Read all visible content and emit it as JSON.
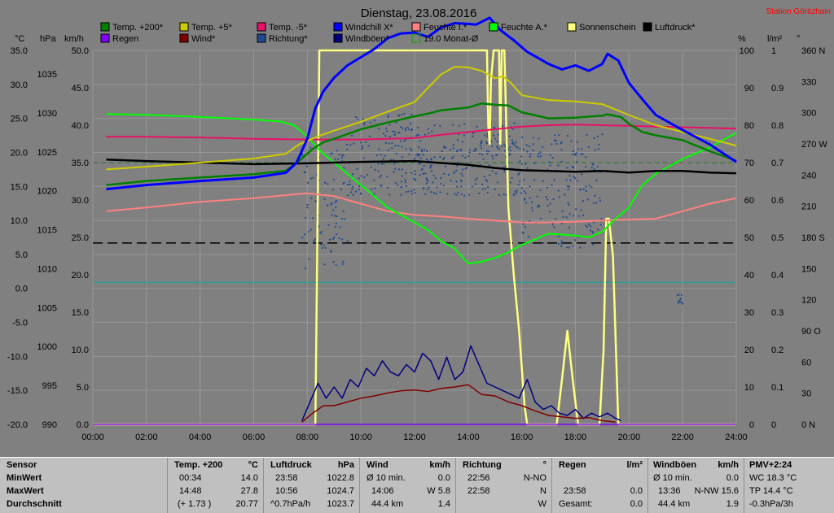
{
  "chart_data": {
    "type": "line",
    "title": "Dienstag, 23.08.2016",
    "station": "Station Göritzhain",
    "legend": [
      {
        "name": "Temp. +200*",
        "color": "#008000"
      },
      {
        "name": "Temp. +5*",
        "color": "#cccc00"
      },
      {
        "name": "Temp. -5*",
        "color": "#e8106a"
      },
      {
        "name": "Windchill X*",
        "color": "#0000ff"
      },
      {
        "name": "Feuchte I.*",
        "color": "#ff8080"
      },
      {
        "name": "Feuchte A.*",
        "color": "#00ff00"
      },
      {
        "name": "Sonnenschein",
        "color": "#ffff80"
      },
      {
        "name": "Luftdruck*",
        "color": "#000000"
      },
      {
        "name": "Regen",
        "color": "#8000ff"
      },
      {
        "name": "Wind*",
        "color": "#800000"
      },
      {
        "name": "Richtung*",
        "color": "#204a90"
      },
      {
        "name": "Windböen*",
        "color": "#000080"
      },
      {
        "name": "19.0 Monat-Ø",
        "color": "#00a000"
      }
    ],
    "axes": {
      "temp": {
        "unit": "°C",
        "ticks": [
          "35.0",
          "30.0",
          "25.0",
          "20.0",
          "15.0",
          "10.0",
          "5.0",
          "0.0",
          "-5.0",
          "-10.0",
          "-15.0",
          "-20.0"
        ],
        "range": [
          -20,
          35
        ]
      },
      "pressure": {
        "unit": "hPa",
        "ticks": [
          "1035",
          "1030",
          "1025",
          "1020",
          "1015",
          "1010",
          "1005",
          "1000",
          "995",
          "990"
        ],
        "range": [
          990,
          1039
        ]
      },
      "wind": {
        "unit": "km/h",
        "ticks": [
          "50.0",
          "45.0",
          "40.0",
          "35.0",
          "30.0",
          "25.0",
          "20.0",
          "15.0",
          "10.0",
          "5.0",
          "0.0"
        ],
        "range": [
          0,
          50
        ]
      },
      "humidity": {
        "unit": "%",
        "ticks": [
          "100",
          "90",
          "80",
          "70",
          "60",
          "50",
          "40",
          "30",
          "20",
          "10",
          "0"
        ],
        "range": [
          0,
          100
        ]
      },
      "rain": {
        "unit": "l/m²",
        "ticks": [
          "1",
          "0.9",
          "0.8",
          "0.7",
          "0.6",
          "0.5",
          "0.4",
          "0.3",
          "0.2",
          "0.1",
          "0"
        ],
        "range": [
          0,
          1
        ]
      },
      "direction": {
        "unit": "°",
        "ticks": [
          "360 N",
          "330",
          "300",
          "270 W",
          "240",
          "210",
          "180 S",
          "150",
          "120",
          "90 O",
          "60",
          "30",
          "0 N"
        ],
        "range": [
          0,
          360
        ]
      },
      "time": {
        "ticks": [
          "00:00",
          "02:00",
          "04:00",
          "06:00",
          "08:00",
          "10:00",
          "12:00",
          "14:00",
          "16:00",
          "18:00",
          "20:00",
          "22:00",
          "24:00"
        ],
        "range": [
          0,
          24
        ]
      }
    },
    "reference_lines": {
      "pressure_mean_hPa": 1024.3,
      "humidity_mean_pct": 48.5,
      "monthly_mean_temp_C": 19.0
    },
    "series": [
      {
        "name": "Temp. +200*",
        "axis": "temp",
        "x": [
          0.5,
          2,
          4,
          6,
          7.2,
          7.7,
          8.2,
          8.6,
          9,
          10,
          11,
          12,
          12.5,
          13,
          14,
          14.5,
          15,
          15.5,
          16,
          17,
          18,
          19,
          19.2,
          19.7,
          20,
          20.5,
          21,
          22,
          23,
          24
        ],
        "y": [
          15.2,
          15.8,
          16.3,
          16.8,
          17.3,
          18.8,
          20.5,
          21.5,
          22,
          23.4,
          24.4,
          25.3,
          25.7,
          26.2,
          26.6,
          27.2,
          27.0,
          26.9,
          25.9,
          25.0,
          25.1,
          25.4,
          25.6,
          25.2,
          24.2,
          23.0,
          22.5,
          21.8,
          20.2,
          18.8
        ]
      },
      {
        "name": "Temp. +5*",
        "axis": "temp",
        "x": [
          0.5,
          2,
          4,
          6,
          7.2,
          7.7,
          8.5,
          9,
          10,
          11,
          12,
          12.5,
          13,
          13.5,
          14,
          14.5,
          15,
          15.3,
          15.6,
          16,
          17,
          18,
          19,
          20,
          21,
          22,
          23,
          24
        ],
        "y": [
          17.5,
          17.9,
          18.5,
          19.1,
          19.8,
          21.2,
          22.5,
          23.2,
          24.5,
          26.0,
          27.4,
          29.5,
          31.5,
          32.6,
          32.5,
          32.0,
          30.9,
          31.2,
          30.2,
          28.4,
          27.7,
          27.5,
          27.1,
          25.5,
          24.0,
          23.0,
          22.0,
          21.0
        ]
      },
      {
        "name": "Temp. -5*",
        "axis": "temp",
        "x": [
          0.5,
          2,
          4,
          6,
          8,
          10,
          12,
          13,
          14,
          15,
          16,
          17,
          18,
          19,
          20,
          21,
          22,
          23,
          24
        ],
        "y": [
          22.3,
          22.3,
          22.2,
          22.0,
          21.9,
          21.9,
          22.1,
          22.6,
          23.0,
          23.4,
          23.8,
          24.0,
          24.1,
          24.0,
          23.9,
          23.8,
          23.7,
          23.6,
          23.5
        ]
      },
      {
        "name": "Windchill X*",
        "axis": "temp",
        "x": [
          0.5,
          2,
          4,
          6,
          7.2,
          7.6,
          8,
          8.3,
          8.6,
          9,
          9.5,
          10,
          10.5,
          11,
          11.5,
          12,
          12.5,
          13,
          13.5,
          14,
          14.3,
          14.8,
          15.2,
          15.7,
          16.2,
          17,
          17.5,
          18,
          18.5,
          19,
          19.2,
          19.6,
          20,
          20.5,
          21,
          22,
          23,
          24
        ],
        "y": [
          14.6,
          15.2,
          15.8,
          16.3,
          17.0,
          18.5,
          22.0,
          26.5,
          29.0,
          31.0,
          32.8,
          34.0,
          35.2,
          36.8,
          37.5,
          37.6,
          37.0,
          38.4,
          39.0,
          38.9,
          38.8,
          39.8,
          38.0,
          36.5,
          34.8,
          33.0,
          32.2,
          32.8,
          32.0,
          33.0,
          34.5,
          33.5,
          30.2,
          27.8,
          25.5,
          23.3,
          21.2,
          18.6
        ]
      },
      {
        "name": "Feuchte I.*",
        "axis": "humidity",
        "x": [
          0.5,
          2,
          4,
          6,
          7.5,
          8,
          9,
          10,
          11,
          12,
          13,
          14,
          15,
          16,
          17,
          18,
          19,
          20,
          21,
          22,
          23,
          24
        ],
        "y": [
          57,
          58,
          59.5,
          60.5,
          61.5,
          61.8,
          61,
          59,
          57,
          56,
          55.6,
          55,
          54.5,
          54,
          54,
          54.2,
          54.5,
          54.8,
          55,
          57,
          59,
          60.5
        ]
      },
      {
        "name": "Feuchte A.*",
        "axis": "humidity",
        "x": [
          0.5,
          2,
          4,
          6,
          7,
          7.5,
          8,
          8.5,
          9,
          9.5,
          10,
          10.5,
          11,
          11.5,
          12,
          12.5,
          13,
          13.5,
          14,
          14.5,
          15,
          15.5,
          16,
          17,
          18,
          18.5,
          19,
          19.5,
          20,
          20.5,
          21,
          21.5,
          22,
          23,
          24
        ],
        "y": [
          83,
          82.8,
          82.2,
          81.5,
          81,
          80,
          77,
          73,
          70,
          67,
          64,
          61,
          58,
          56,
          54,
          52,
          49,
          47,
          43,
          43.5,
          44.5,
          46,
          48,
          51,
          50.5,
          50,
          51.5,
          55,
          58,
          64,
          67,
          69,
          71,
          74,
          78
        ]
      },
      {
        "name": "Luftdruck*",
        "axis": "pressure",
        "x": [
          0.5,
          2,
          4,
          6,
          8,
          10,
          12,
          14,
          15,
          16,
          17,
          18,
          19,
          20,
          21,
          22,
          23,
          24
        ],
        "y": [
          1024.7,
          1024.5,
          1024.3,
          1024.1,
          1024.2,
          1024.4,
          1024.5,
          1024.0,
          1023.6,
          1023.3,
          1023.2,
          1023.1,
          1023.2,
          1023.0,
          1023.2,
          1023.2,
          1023.0,
          1022.9
        ]
      },
      {
        "name": "Sonnenschein",
        "axis": "humidity",
        "x": [
          0,
          8.3,
          8.45,
          8.5,
          14.7,
          14.75,
          14.8,
          14.85,
          14.95,
          15.05,
          15.15,
          15.2,
          15.25,
          15.35,
          15.5,
          15.7,
          15.9,
          16.1,
          16.2,
          17.3,
          17.5,
          17.7,
          17.9,
          18.1,
          18.9,
          19.05,
          19.15,
          19.25,
          19.4,
          19.6,
          24
        ],
        "y": [
          0,
          0,
          100,
          100,
          100,
          80,
          75,
          92,
          100,
          100,
          100,
          75,
          100,
          100,
          58,
          40,
          25,
          5,
          0,
          0,
          12,
          25,
          12,
          0,
          0,
          20,
          55,
          55,
          45,
          0,
          0
        ]
      },
      {
        "name": "Windböen*",
        "axis": "wind",
        "x": [
          7.8,
          8.1,
          8.4,
          8.7,
          9,
          9.3,
          9.6,
          9.9,
          10.2,
          10.5,
          10.8,
          11.1,
          11.4,
          11.7,
          12,
          12.3,
          12.6,
          12.9,
          13.2,
          13.5,
          13.8,
          14.1,
          14.4,
          14.7,
          15,
          15.3,
          15.6,
          15.9,
          16.2,
          16.5,
          16.8,
          17.1,
          17.4,
          17.7,
          18,
          18.3,
          18.6,
          18.9,
          19.2,
          19.5,
          19.7
        ],
        "y": [
          0.5,
          3,
          5.5,
          3.5,
          5,
          3.5,
          6,
          5,
          7.5,
          6.5,
          8.5,
          7,
          6.5,
          8,
          7,
          9.5,
          8.5,
          6,
          9,
          6,
          7,
          10.5,
          8,
          5.5,
          5,
          4.5,
          4,
          3.5,
          6,
          3,
          2,
          2.5,
          1.5,
          1.2,
          2,
          0.8,
          1.5,
          1,
          1.5,
          0.8,
          0.5
        ]
      },
      {
        "name": "Wind*",
        "axis": "wind",
        "x": [
          7.8,
          8.2,
          8.6,
          9,
          9.5,
          10,
          10.5,
          11,
          11.5,
          12,
          12.5,
          13,
          13.5,
          14,
          14.5,
          15,
          15.5,
          16,
          16.5,
          17,
          17.5,
          18,
          18.5,
          19,
          19.5
        ],
        "y": [
          0.3,
          1.5,
          2.5,
          2.5,
          3,
          3.5,
          3.8,
          4.2,
          4.5,
          4.6,
          4.4,
          4.8,
          5,
          5.3,
          4,
          3.8,
          3,
          2.5,
          1.8,
          1.2,
          1,
          0.8,
          0.9,
          0.5,
          0.3
        ]
      },
      {
        "name": "Regen",
        "axis": "rain",
        "x": [
          0,
          24
        ],
        "y": [
          0,
          0
        ]
      }
    ],
    "direction_clouds": [
      {
        "x0": 7.8,
        "x1": 9.5,
        "y0": 150,
        "y1": 270
      },
      {
        "x0": 9.5,
        "x1": 12.0,
        "y0": 220,
        "y1": 300
      },
      {
        "x0": 12.0,
        "x1": 16.0,
        "y0": 220,
        "y1": 290
      },
      {
        "x0": 16.0,
        "x1": 19.0,
        "y0": 170,
        "y1": 280
      },
      {
        "x0": 21.8,
        "x1": 22.0,
        "y0": 115,
        "y1": 125
      }
    ]
  },
  "stats": {
    "sensor": {
      "header": "Sensor",
      "rows": [
        "MinWert",
        "MaxWert",
        "Durchschnitt"
      ]
    },
    "temp": {
      "header": "Temp. +200",
      "unit": "°C",
      "rows": [
        [
          "00:34",
          "14.0"
        ],
        [
          "14:48",
          "27.8"
        ],
        [
          "(+ 1.73 )",
          "20.77"
        ]
      ]
    },
    "pressure": {
      "header": "Luftdruck",
      "unit": "hPa",
      "rows": [
        [
          "23:58",
          "1022.8"
        ],
        [
          "10:56",
          "1024.7"
        ],
        [
          "^0.7hPa/h",
          "1023.7"
        ]
      ]
    },
    "wind": {
      "header": "Wind",
      "unit": "km/h",
      "rows": [
        [
          "Ø 10 min.",
          "0.0"
        ],
        [
          "14:06",
          "W 5.8"
        ],
        [
          "44.4 km",
          "1.4"
        ]
      ]
    },
    "direction": {
      "header": "Richtung",
      "unit": "°",
      "rows": [
        [
          "22:56",
          "N-NO"
        ],
        [
          "22:58",
          "N"
        ],
        [
          "",
          "W"
        ]
      ]
    },
    "rain": {
      "header": "Regen",
      "unit": "l/m²",
      "rows": [
        [
          "",
          ""
        ],
        [
          "23:58",
          "0.0"
        ],
        [
          "Gesamt:",
          "0.0"
        ]
      ]
    },
    "gusts": {
      "header": "Windböen",
      "unit": "km/h",
      "rows": [
        [
          "Ø 10 min.",
          "0.0"
        ],
        [
          "13:36",
          "N-NW 15.6"
        ],
        [
          "44.4 km",
          "1.9"
        ]
      ]
    },
    "pmv": {
      "header": "PMV+2:24",
      "rows": [
        "WC 18.3 °C",
        "TP 14.4 °C",
        "-0.3hPa/3h"
      ]
    }
  }
}
